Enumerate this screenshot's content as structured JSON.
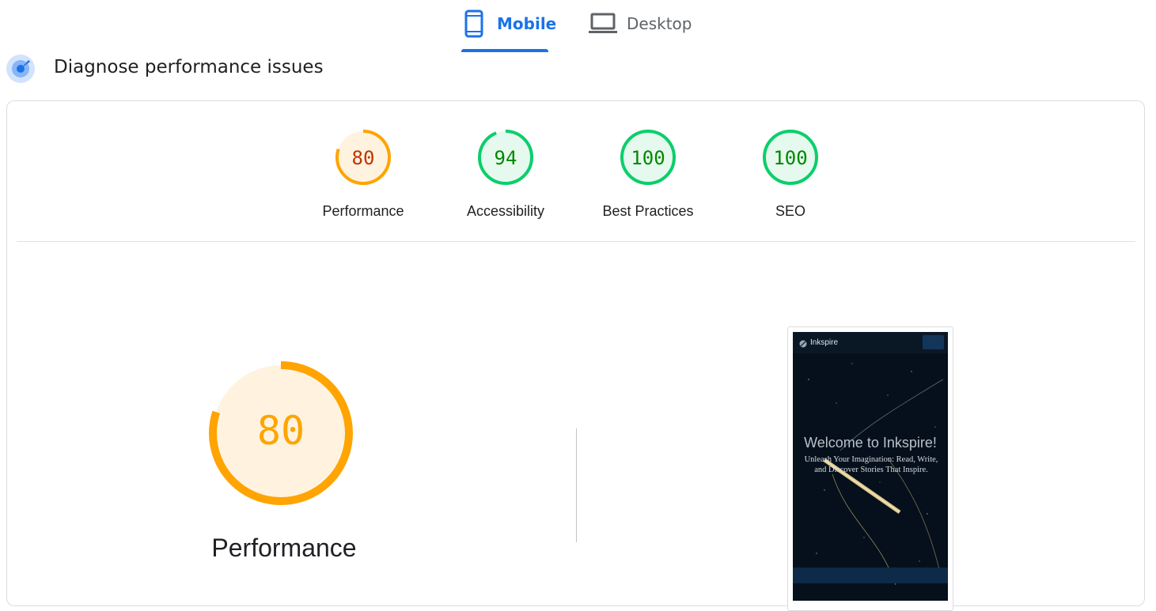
{
  "tabs": [
    {
      "label": "Mobile",
      "icon": "smartphone-icon",
      "selected": true
    },
    {
      "label": "Desktop",
      "icon": "laptop-icon",
      "selected": false
    }
  ],
  "section": {
    "title": "Diagnose performance issues",
    "icon": "lighthouse-icon"
  },
  "gauges": [
    {
      "label": "Performance",
      "score": "80",
      "status": "average",
      "color": "#ffa400",
      "score_color": "#c33300",
      "fill": "#fff3e0",
      "fraction": 0.8
    },
    {
      "label": "Accessibility",
      "score": "94",
      "status": "pass",
      "color": "#0cce6b",
      "score_color": "#008800",
      "fill": "#e6f9ee",
      "fraction": 0.94
    },
    {
      "label": "Best Practices",
      "score": "100",
      "status": "pass",
      "color": "#0cce6b",
      "score_color": "#008800",
      "fill": "#e6f9ee",
      "fraction": 1.0
    },
    {
      "label": "SEO",
      "score": "100",
      "status": "pass",
      "color": "#0cce6b",
      "score_color": "#008800",
      "fill": "#e6f9ee",
      "fraction": 1.0
    }
  ],
  "performance_detail": {
    "score": "80",
    "label": "Performance",
    "color": "#ffa400",
    "fill": "#fff3e0",
    "fraction": 0.8
  },
  "screenshot_preview": {
    "brand": "Inkspire",
    "title": "Welcome to Inkspire!",
    "subtitle": "Unleash Your Imagination: Read, Write, and Discover Stories That Inspire."
  },
  "colors": {
    "accent": "#1a73e8",
    "average": "#ffa400",
    "pass": "#0cce6b"
  }
}
